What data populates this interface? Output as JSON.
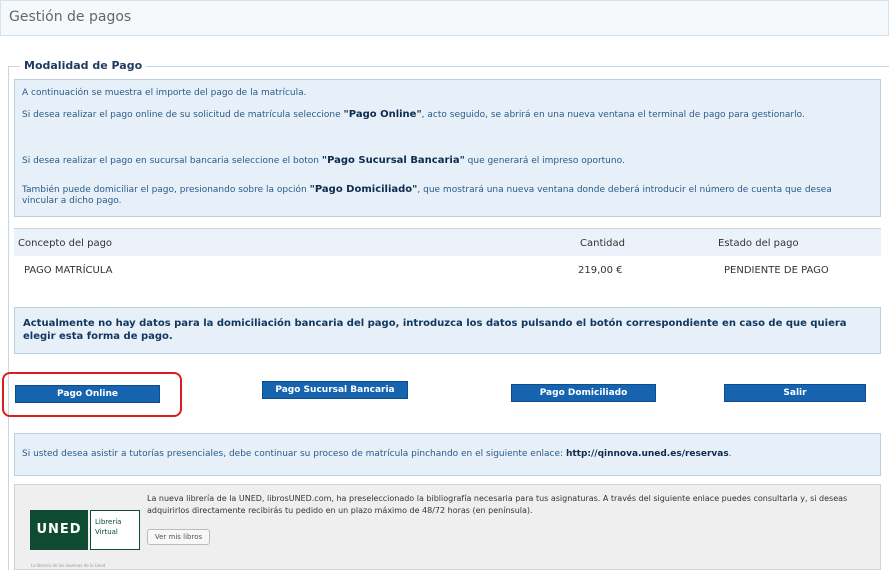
{
  "header": {
    "title": "Gestión de pagos"
  },
  "section": {
    "legend": "Modalidad de Pago"
  },
  "info": {
    "p1": "A continuación se muestra el importe del pago de la matrícula.",
    "p2_pre": "Si desea realizar el pago online de su solicitud de matrícula seleccione ",
    "p2_bold": "\"Pago Online\"",
    "p2_post": ", acto seguido, se abrirá en una nueva ventana el terminal de pago para gestionarlo.",
    "p3_pre": "Si desea realizar el pago en sucursal bancaria seleccione el boton ",
    "p3_bold": "\"Pago Sucursal Bancaria\"",
    "p3_post": " que generará el impreso oportuno.",
    "p4_pre": "También puede domiciliar el pago, presionando sobre la opción ",
    "p4_bold": "\"Pago Domiciliado\"",
    "p4_post": ", que mostrará una nueva ventana donde deberá introducir el número de cuenta que desea vincular a dicho pago."
  },
  "table": {
    "headers": [
      "Concepto del pago",
      "Cantidad",
      "Estado del pago"
    ],
    "rows": [
      {
        "concepto": "PAGO MATRÍCULA",
        "cantidad": "219,00 €",
        "estado": "PENDIENTE DE PAGO"
      }
    ]
  },
  "warning": "Actualmente no hay datos para la domiciliación bancaria del pago, introduzca los datos pulsando el botón correspondiente en caso de que quiera elegir esta forma de pago.",
  "buttons": {
    "online": "Pago Online",
    "sucursal": "Pago Sucursal Bancaria",
    "domiciliado": "Pago Domiciliado",
    "salir": "Salir"
  },
  "tutorias": {
    "text": "Si usted desea asistir a tutorías presenciales, debe continuar su proceso de matrícula pinchando en el siguiente enlace: ",
    "link": "http://qinnova.uned.es/reservas",
    "end": "."
  },
  "libreria": {
    "logo_main": "UNED",
    "logo_side_1": "Librería",
    "logo_side_2": "Virtual",
    "logo_tagline": "La librería de los alumnos de la Uned",
    "text": "La nueva librería de la UNED, librosUNED.com, ha preseleccionado la bibliografía necesaria para tus asignaturas. A través del siguiente enlace puedes consultarla y, si deseas adquirirlos directamente recibirás tu pedido en un plazo máximo de 48/72 horas (en península).",
    "button": "Ver mis libros"
  },
  "colors": {
    "accent": "#1664b0",
    "highlight": "#d81f1f",
    "panel": "#e7f0f8"
  }
}
